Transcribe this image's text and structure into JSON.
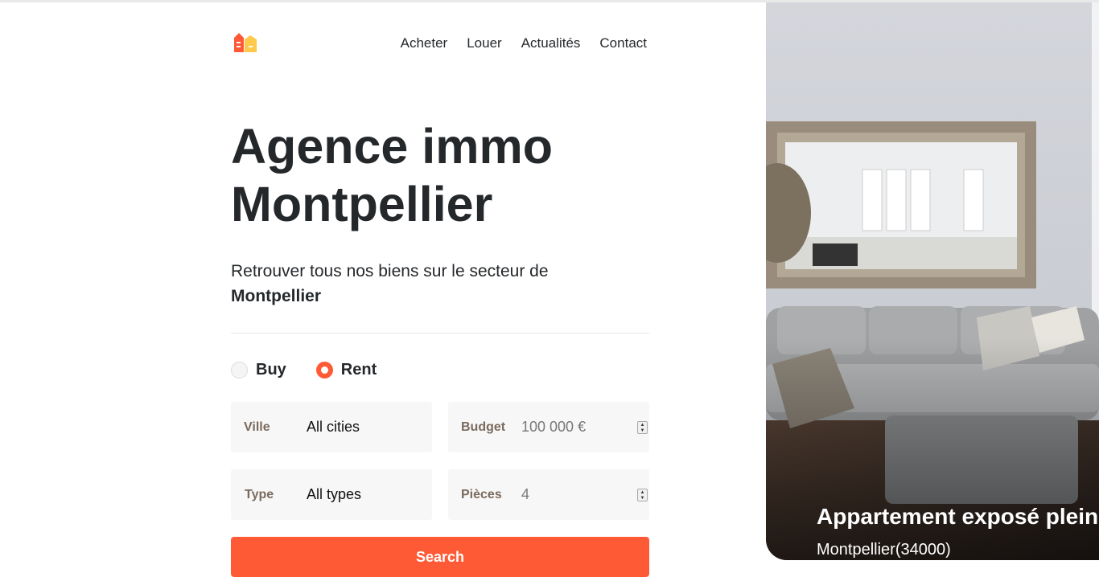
{
  "nav": {
    "items": [
      {
        "label": "Acheter"
      },
      {
        "label": "Louer"
      },
      {
        "label": "Actualités"
      },
      {
        "label": "Contact"
      }
    ]
  },
  "logo": {
    "icon": "house-logo-icon",
    "colors": [
      "#ff5a36",
      "#ffc94d"
    ]
  },
  "hero": {
    "title_line1": "Agence immo",
    "title_line2": "Montpellier",
    "subtitle": "Retrouver tous nos biens sur le secteur de",
    "subtitle_city": "Montpellier"
  },
  "search": {
    "mode_options": [
      {
        "label": "Buy",
        "checked": false
      },
      {
        "label": "Rent",
        "checked": true
      }
    ],
    "ville": {
      "label": "Ville",
      "value": "All cities"
    },
    "budget": {
      "label": "Budget",
      "placeholder": "100 000 €"
    },
    "type": {
      "label": "Type",
      "value": "All types"
    },
    "pieces": {
      "label": "Pièces",
      "placeholder": "4"
    },
    "button_label": "Search"
  },
  "featured": {
    "title": "Appartement exposé plein",
    "location": "Montpellier(34000)"
  },
  "colors": {
    "accent": "#ff5a36",
    "text": "#25282b",
    "field_bg": "#f7f7f7"
  }
}
